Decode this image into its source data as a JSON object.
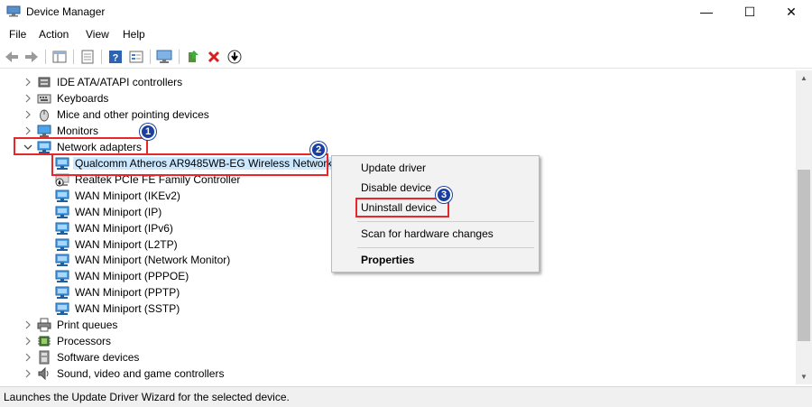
{
  "window": {
    "title": "Device Manager",
    "minimize": "—",
    "maximize": "☐",
    "close": "✕"
  },
  "menu": [
    "File",
    "Action",
    "View",
    "Help"
  ],
  "tree": [
    {
      "label": "IDE ATA/ATAPI controllers",
      "level": 1,
      "expander": "collapsed",
      "icon": "ide-controller-icon"
    },
    {
      "label": "Keyboards",
      "level": 1,
      "expander": "collapsed",
      "icon": "keyboard-icon"
    },
    {
      "label": "Mice and other pointing devices",
      "level": 1,
      "expander": "collapsed",
      "icon": "mouse-icon"
    },
    {
      "label": "Monitors",
      "level": 1,
      "expander": "collapsed",
      "icon": "monitor-icon"
    },
    {
      "label": "Network adapters",
      "level": 1,
      "expander": "expanded",
      "icon": "network-adapter-icon"
    },
    {
      "label": "Qualcomm Atheros AR9485WB-EG Wireless Network",
      "level": 2,
      "expander": "none",
      "icon": "network-adapter-icon",
      "selected": true
    },
    {
      "label": "Realtek PCIe FE Family Controller",
      "level": 2,
      "expander": "none",
      "icon": "network-adapter-disabled-icon"
    },
    {
      "label": "WAN Miniport (IKEv2)",
      "level": 2,
      "expander": "none",
      "icon": "network-adapter-icon"
    },
    {
      "label": "WAN Miniport (IP)",
      "level": 2,
      "expander": "none",
      "icon": "network-adapter-icon"
    },
    {
      "label": "WAN Miniport (IPv6)",
      "level": 2,
      "expander": "none",
      "icon": "network-adapter-icon"
    },
    {
      "label": "WAN Miniport (L2TP)",
      "level": 2,
      "expander": "none",
      "icon": "network-adapter-icon"
    },
    {
      "label": "WAN Miniport (Network Monitor)",
      "level": 2,
      "expander": "none",
      "icon": "network-adapter-icon"
    },
    {
      "label": "WAN Miniport (PPPOE)",
      "level": 2,
      "expander": "none",
      "icon": "network-adapter-icon"
    },
    {
      "label": "WAN Miniport (PPTP)",
      "level": 2,
      "expander": "none",
      "icon": "network-adapter-icon"
    },
    {
      "label": "WAN Miniport (SSTP)",
      "level": 2,
      "expander": "none",
      "icon": "network-adapter-icon"
    },
    {
      "label": "Print queues",
      "level": 1,
      "expander": "collapsed",
      "icon": "printer-icon"
    },
    {
      "label": "Processors",
      "level": 1,
      "expander": "collapsed",
      "icon": "processor-icon"
    },
    {
      "label": "Software devices",
      "level": 1,
      "expander": "collapsed",
      "icon": "software-device-icon"
    },
    {
      "label": "Sound, video and game controllers",
      "level": 1,
      "expander": "collapsed",
      "icon": "speaker-icon"
    }
  ],
  "context_menu": {
    "update": "Update driver",
    "disable": "Disable device",
    "uninstall": "Uninstall device",
    "scan": "Scan for hardware changes",
    "properties": "Properties"
  },
  "annotations": [
    "1",
    "2",
    "3"
  ],
  "status": "Launches the Update Driver Wizard for the selected device.",
  "colors": {
    "selection": "#cce8ff",
    "annotation_red": "#e8272b",
    "badge_blue": "#1a3fa0"
  }
}
